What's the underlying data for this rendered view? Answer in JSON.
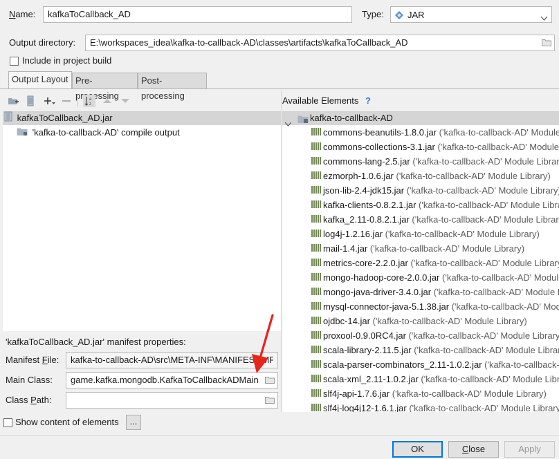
{
  "name": {
    "label": "Name:",
    "value": "kafkaToCallback_AD"
  },
  "type": {
    "label": "Type:",
    "value": "JAR",
    "icon": "diamond-icon"
  },
  "output_dir": {
    "label": "Output directory:",
    "value": "E:\\workspaces_idea\\kafka-to-callback-AD\\classes\\artifacts\\kafkaToCallback_AD"
  },
  "include_build": {
    "label": "Include in project build",
    "checked": false
  },
  "tabs": [
    {
      "label": "Output Layout",
      "active": true
    },
    {
      "label": "Pre-processing",
      "active": false
    },
    {
      "label": "Post-processing",
      "active": false
    }
  ],
  "layout_tree": [
    {
      "label": "kafkaToCallback_AD.jar",
      "icon": "jar-file-icon",
      "selected": true
    },
    {
      "label": "'kafka-to-callback-AD' compile output",
      "icon": "folder-icon",
      "selected": false
    }
  ],
  "available": {
    "title": "Available Elements",
    "help": "?",
    "root": "kafka-to-callback-AD",
    "items": [
      {
        "name": "commons-beanutils-1.8.0.jar",
        "sub": "('kafka-to-callback-AD' Module Library)"
      },
      {
        "name": "commons-collections-3.1.jar",
        "sub": "('kafka-to-callback-AD' Module Library)"
      },
      {
        "name": "commons-lang-2.5.jar",
        "sub": "('kafka-to-callback-AD' Module Library)"
      },
      {
        "name": "ezmorph-1.0.6.jar",
        "sub": "('kafka-to-callback-AD' Module Library)"
      },
      {
        "name": "json-lib-2.4-jdk15.jar",
        "sub": "('kafka-to-callback-AD' Module Library)"
      },
      {
        "name": "kafka-clients-0.8.2.1.jar",
        "sub": "('kafka-to-callback-AD' Module Library)"
      },
      {
        "name": "kafka_2.11-0.8.2.1.jar",
        "sub": "('kafka-to-callback-AD' Module Library)"
      },
      {
        "name": "log4j-1.2.16.jar",
        "sub": "('kafka-to-callback-AD' Module Library)"
      },
      {
        "name": "mail-1.4.jar",
        "sub": "('kafka-to-callback-AD' Module Library)"
      },
      {
        "name": "metrics-core-2.2.0.jar",
        "sub": "('kafka-to-callback-AD' Module Library)"
      },
      {
        "name": "mongo-hadoop-core-2.0.0.jar",
        "sub": "('kafka-to-callback-AD' Module Library)"
      },
      {
        "name": "mongo-java-driver-3.4.0.jar",
        "sub": "('kafka-to-callback-AD' Module Library)"
      },
      {
        "name": "mysql-connector-java-5.1.38.jar",
        "sub": "('kafka-to-callback-AD' Module Library)"
      },
      {
        "name": "ojdbc-14.jar",
        "sub": "('kafka-to-callback-AD' Module Library)"
      },
      {
        "name": "proxool-0.9.0RC4.jar",
        "sub": "('kafka-to-callback-AD' Module Library)"
      },
      {
        "name": "scala-library-2.11.5.jar",
        "sub": "('kafka-to-callback-AD' Module Library)"
      },
      {
        "name": "scala-parser-combinators_2.11-1.0.2.jar",
        "sub": "('kafka-to-callback-AD' Module Library)"
      },
      {
        "name": "scala-xml_2.11-1.0.2.jar",
        "sub": "('kafka-to-callback-AD' Module Library)"
      },
      {
        "name": "slf4j-api-1.7.6.jar",
        "sub": "('kafka-to-callback-AD' Module Library)"
      },
      {
        "name": "slf4j-log4j12-1.6.1.jar",
        "sub": "('kafka-to-callback-AD' Module Library)"
      }
    ]
  },
  "manifest": {
    "title": "'kafkaToCallback_AD.jar' manifest properties:",
    "file_label": "Manifest File:",
    "file_value": "kafka-to-callback-AD\\src\\META-INF\\MANIFEST.MF",
    "main_label": "Main Class:",
    "main_value": "game.kafka.mongodb.KafkaToCallbackADMain",
    "classpath_label": "Class Path:",
    "classpath_value": ""
  },
  "show_content": {
    "label": "Show content of elements",
    "checked": false,
    "more": "..."
  },
  "buttons": {
    "ok": "OK",
    "close": "Close",
    "apply": "Apply"
  },
  "colors": {
    "selection": "#d5d5d5",
    "accent": "#0078d7",
    "arrow": "#e8251b"
  }
}
